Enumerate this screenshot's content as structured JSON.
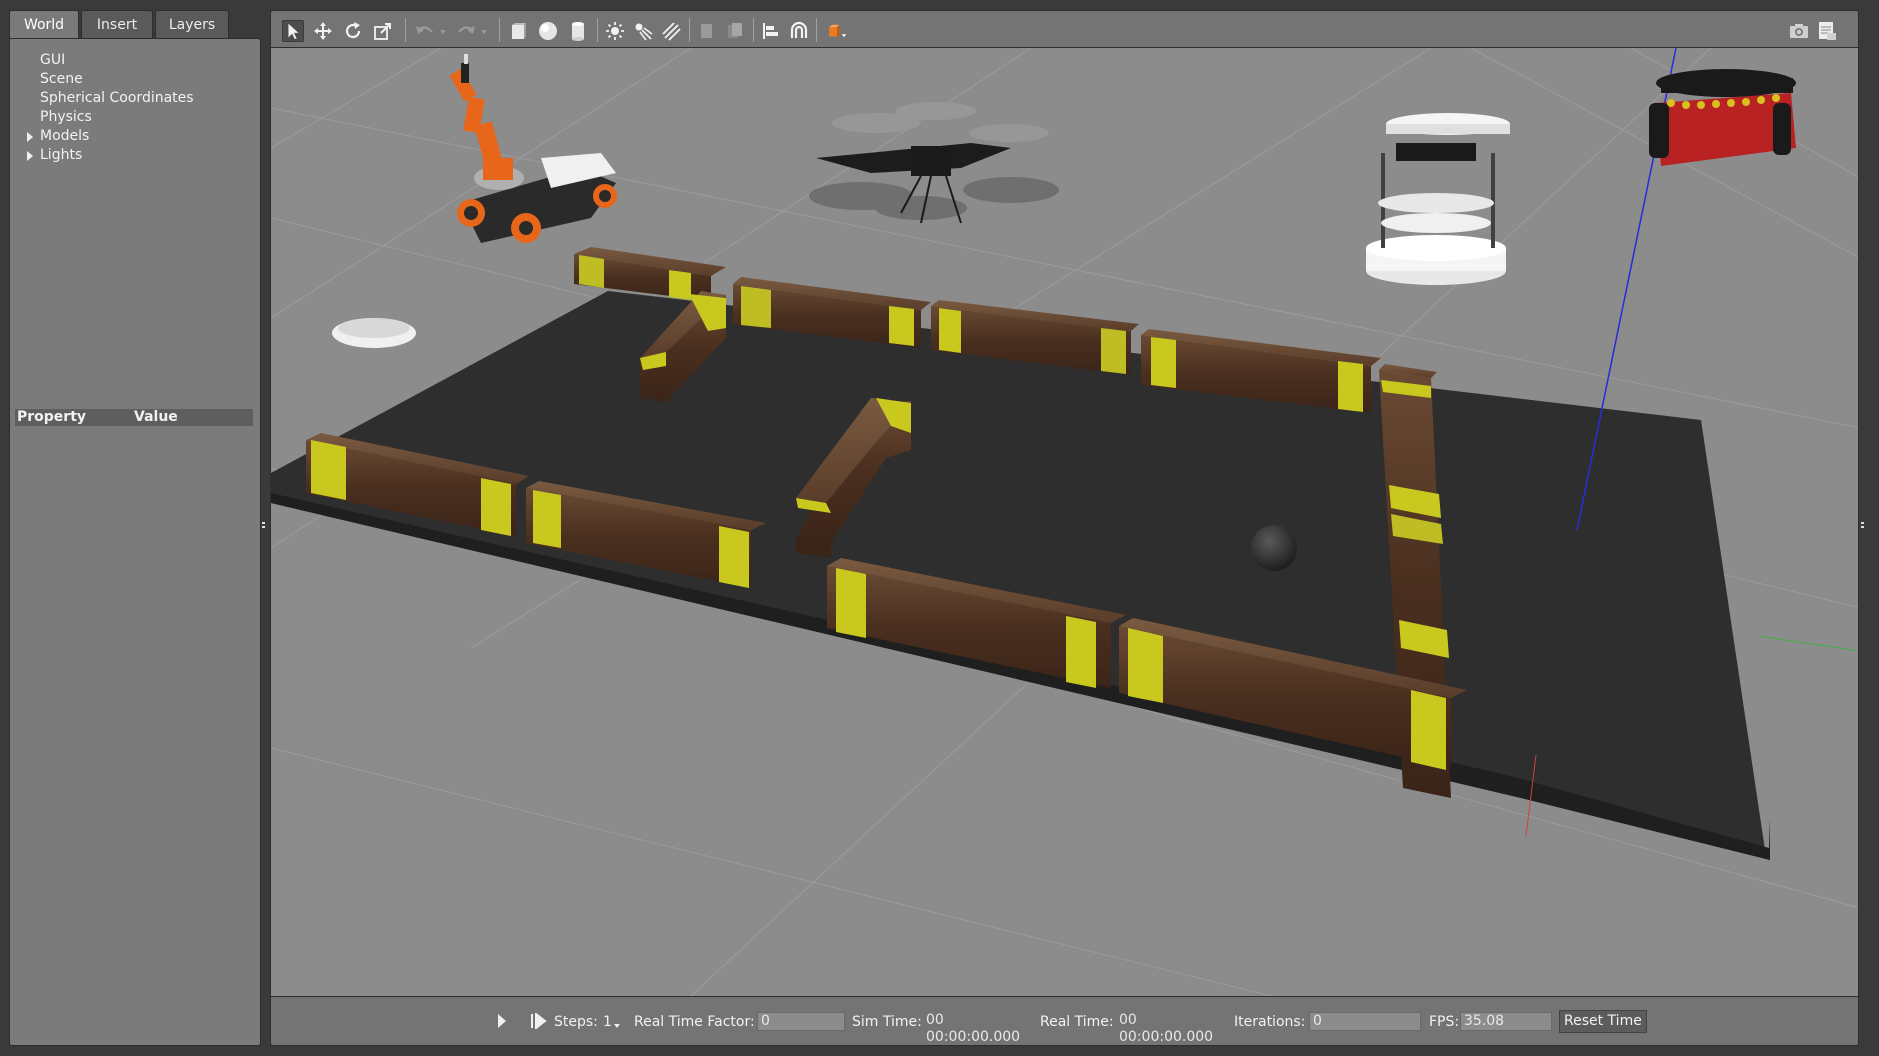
{
  "left_panel": {
    "tabs": [
      {
        "label": "World",
        "active": true
      },
      {
        "label": "Insert",
        "active": false
      },
      {
        "label": "Layers",
        "active": false
      }
    ],
    "tree": [
      {
        "label": "GUI",
        "expandable": false
      },
      {
        "label": "Scene",
        "expandable": false
      },
      {
        "label": "Spherical Coordinates",
        "expandable": false
      },
      {
        "label": "Physics",
        "expandable": false
      },
      {
        "label": "Models",
        "expandable": true
      },
      {
        "label": "Lights",
        "expandable": true
      }
    ],
    "property_header": {
      "property": "Property",
      "value": "Value"
    }
  },
  "toolbar": {
    "icons": [
      "select-arrow-icon",
      "translate-icon",
      "rotate-icon",
      "scale-icon",
      "undo-icon",
      "undo-history-icon",
      "redo-icon",
      "redo-history-icon",
      "box-icon",
      "sphere-icon",
      "cylinder-icon",
      "point-light-icon",
      "spot-light-icon",
      "directional-light-icon",
      "copy-icon",
      "paste-icon",
      "align-icon",
      "snap-icon",
      "view-angle-icon",
      "screenshot-icon",
      "log-icon"
    ],
    "accent_color": "#ee7a1c"
  },
  "bottom_bar": {
    "steps_label": "Steps:",
    "steps_value": "1",
    "real_time_factor_label": "Real Time Factor:",
    "real_time_factor_value": "0",
    "sim_time_label": "Sim Time:",
    "sim_time_value": "00 00:00:00.000",
    "real_time_label": "Real Time:",
    "real_time_value": "00 00:00:00.000",
    "iterations_label": "Iterations:",
    "iterations_value": "0",
    "fps_label": "FPS:",
    "fps_value": "35.08",
    "reset_time_label": "Reset Time"
  },
  "colors": {
    "ground": "#8a8a8a",
    "platform": "#2f2f2f",
    "wall_wood": "#4a2f1f",
    "wall_stripe": "#c8c81e",
    "robot_orange": "#e8661a",
    "robot_red": "#b82222",
    "axis_blue": "#2020d0"
  }
}
